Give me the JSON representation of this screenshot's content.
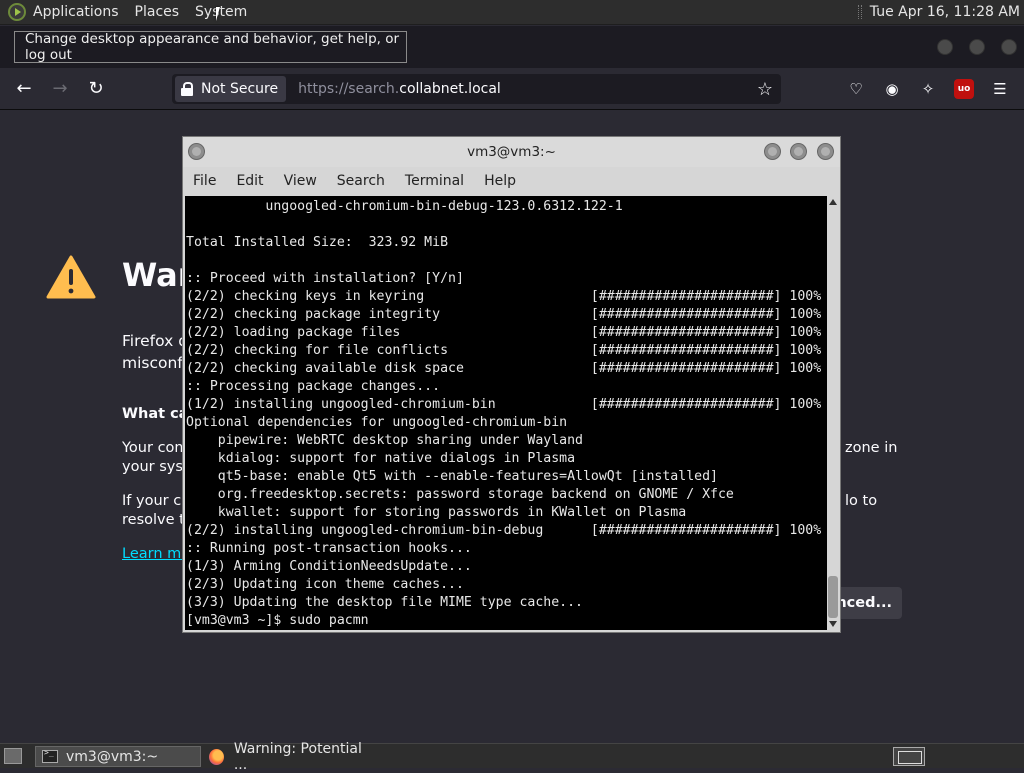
{
  "top_panel": {
    "menus": [
      "Applications",
      "Places",
      "System"
    ],
    "clock": "Tue Apr 16, 11:28 AM"
  },
  "tooltip": "Change desktop appearance and behavior, get help, or log out",
  "browser": {
    "security_label": "Not Secure",
    "url_prefix": "https://search.",
    "url_domain": "collabnet.local"
  },
  "page": {
    "title_partial": "War",
    "line1a": "Firefox d",
    "line1b": "misconf",
    "heading": "What can",
    "para2a": "Your com",
    "para2b": "your syst",
    "para2c": "zone in",
    "para3a": "If your clo",
    "para3b": "resolve th",
    "para3c": "lo to",
    "link": "Learn mo",
    "advanced_button": "nced..."
  },
  "terminal": {
    "title": "vm3@vm3:~",
    "menu": [
      "File",
      "Edit",
      "View",
      "Search",
      "Terminal",
      "Help"
    ],
    "lines": [
      "          ungoogled-chromium-bin-debug-123.0.6312.122-1",
      "",
      "Total Installed Size:  323.92 MiB",
      "",
      ":: Proceed with installation? [Y/n]",
      "(2/2) checking keys in keyring                     [######################] 100%",
      "(2/2) checking package integrity                   [######################] 100%",
      "(2/2) loading package files                        [######################] 100%",
      "(2/2) checking for file conflicts                  [######################] 100%",
      "(2/2) checking available disk space                [######################] 100%",
      ":: Processing package changes...",
      "(1/2) installing ungoogled-chromium-bin            [######################] 100%",
      "Optional dependencies for ungoogled-chromium-bin",
      "    pipewire: WebRTC desktop sharing under Wayland",
      "    kdialog: support for native dialogs in Plasma",
      "    qt5-base: enable Qt5 with --enable-features=AllowQt [installed]",
      "    org.freedesktop.secrets: password storage backend on GNOME / Xfce",
      "    kwallet: support for storing passwords in KWallet on Plasma",
      "(2/2) installing ungoogled-chromium-bin-debug      [######################] 100%",
      ":: Running post-transaction hooks...",
      "(1/3) Arming ConditionNeedsUpdate...",
      "(2/3) Updating icon theme caches...",
      "(3/3) Updating the desktop file MIME type cache...",
      "[vm3@vm3 ~]$ sudo pacmn"
    ]
  },
  "taskbar": {
    "tasks": [
      "vm3@vm3:~",
      "Warning: Potential ..."
    ]
  }
}
